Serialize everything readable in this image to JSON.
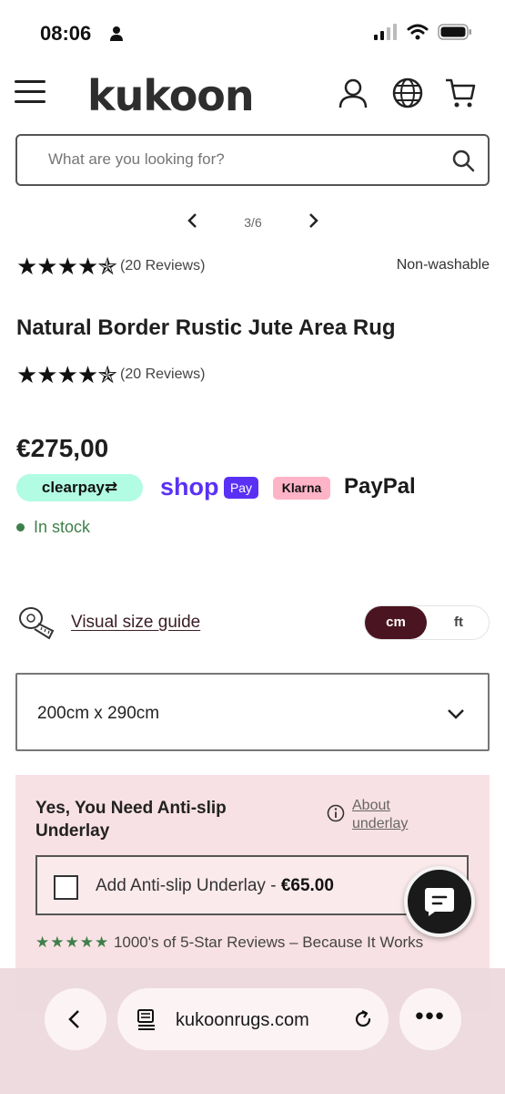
{
  "status_bar": {
    "time": "08:06"
  },
  "header": {
    "logo": "kukoon"
  },
  "search": {
    "placeholder": "What are you looking for?"
  },
  "gallery": {
    "counter": "3/6"
  },
  "rating_top": {
    "stars": "★★★★✯",
    "reviews": "(20 Reviews)",
    "washable": "Non-washable"
  },
  "product": {
    "title": "Natural Border Rustic Jute Area Rug",
    "stars": "★★★★✯",
    "reviews": "(20 Reviews)",
    "price": "€275,00",
    "stock": "In stock",
    "rating_value": 4.5
  },
  "payments": {
    "clearpay": "clearpay⇄",
    "shop": "shop",
    "shop_badge": "Pay",
    "klarna": "Klarna",
    "paypal": "PayPal"
  },
  "size_guide": {
    "label": "Visual size guide",
    "unit_cm": "cm",
    "unit_ft": "ft",
    "selected_unit": "cm"
  },
  "size_select": {
    "value": "200cm x 290cm"
  },
  "underlay": {
    "title": "Yes, You Need Anti-slip Underlay",
    "about": "About underlay",
    "addon_label": "Add Anti-slip Underlay - ",
    "addon_price": "€65.00",
    "review_stars": "★★★★★",
    "review_text": "1000's of 5-Star Reviews – Because It Works"
  },
  "browser": {
    "url": "kukoonrugs.com",
    "more": "•••"
  },
  "colors": {
    "accent": "#4a1420",
    "stock_green": "#3f7f4b",
    "underlay_bg": "#f8e1e4",
    "clearpay": "#b2fce4",
    "shop_purple": "#5a31f4",
    "klarna_pink": "#ffb3c7"
  }
}
